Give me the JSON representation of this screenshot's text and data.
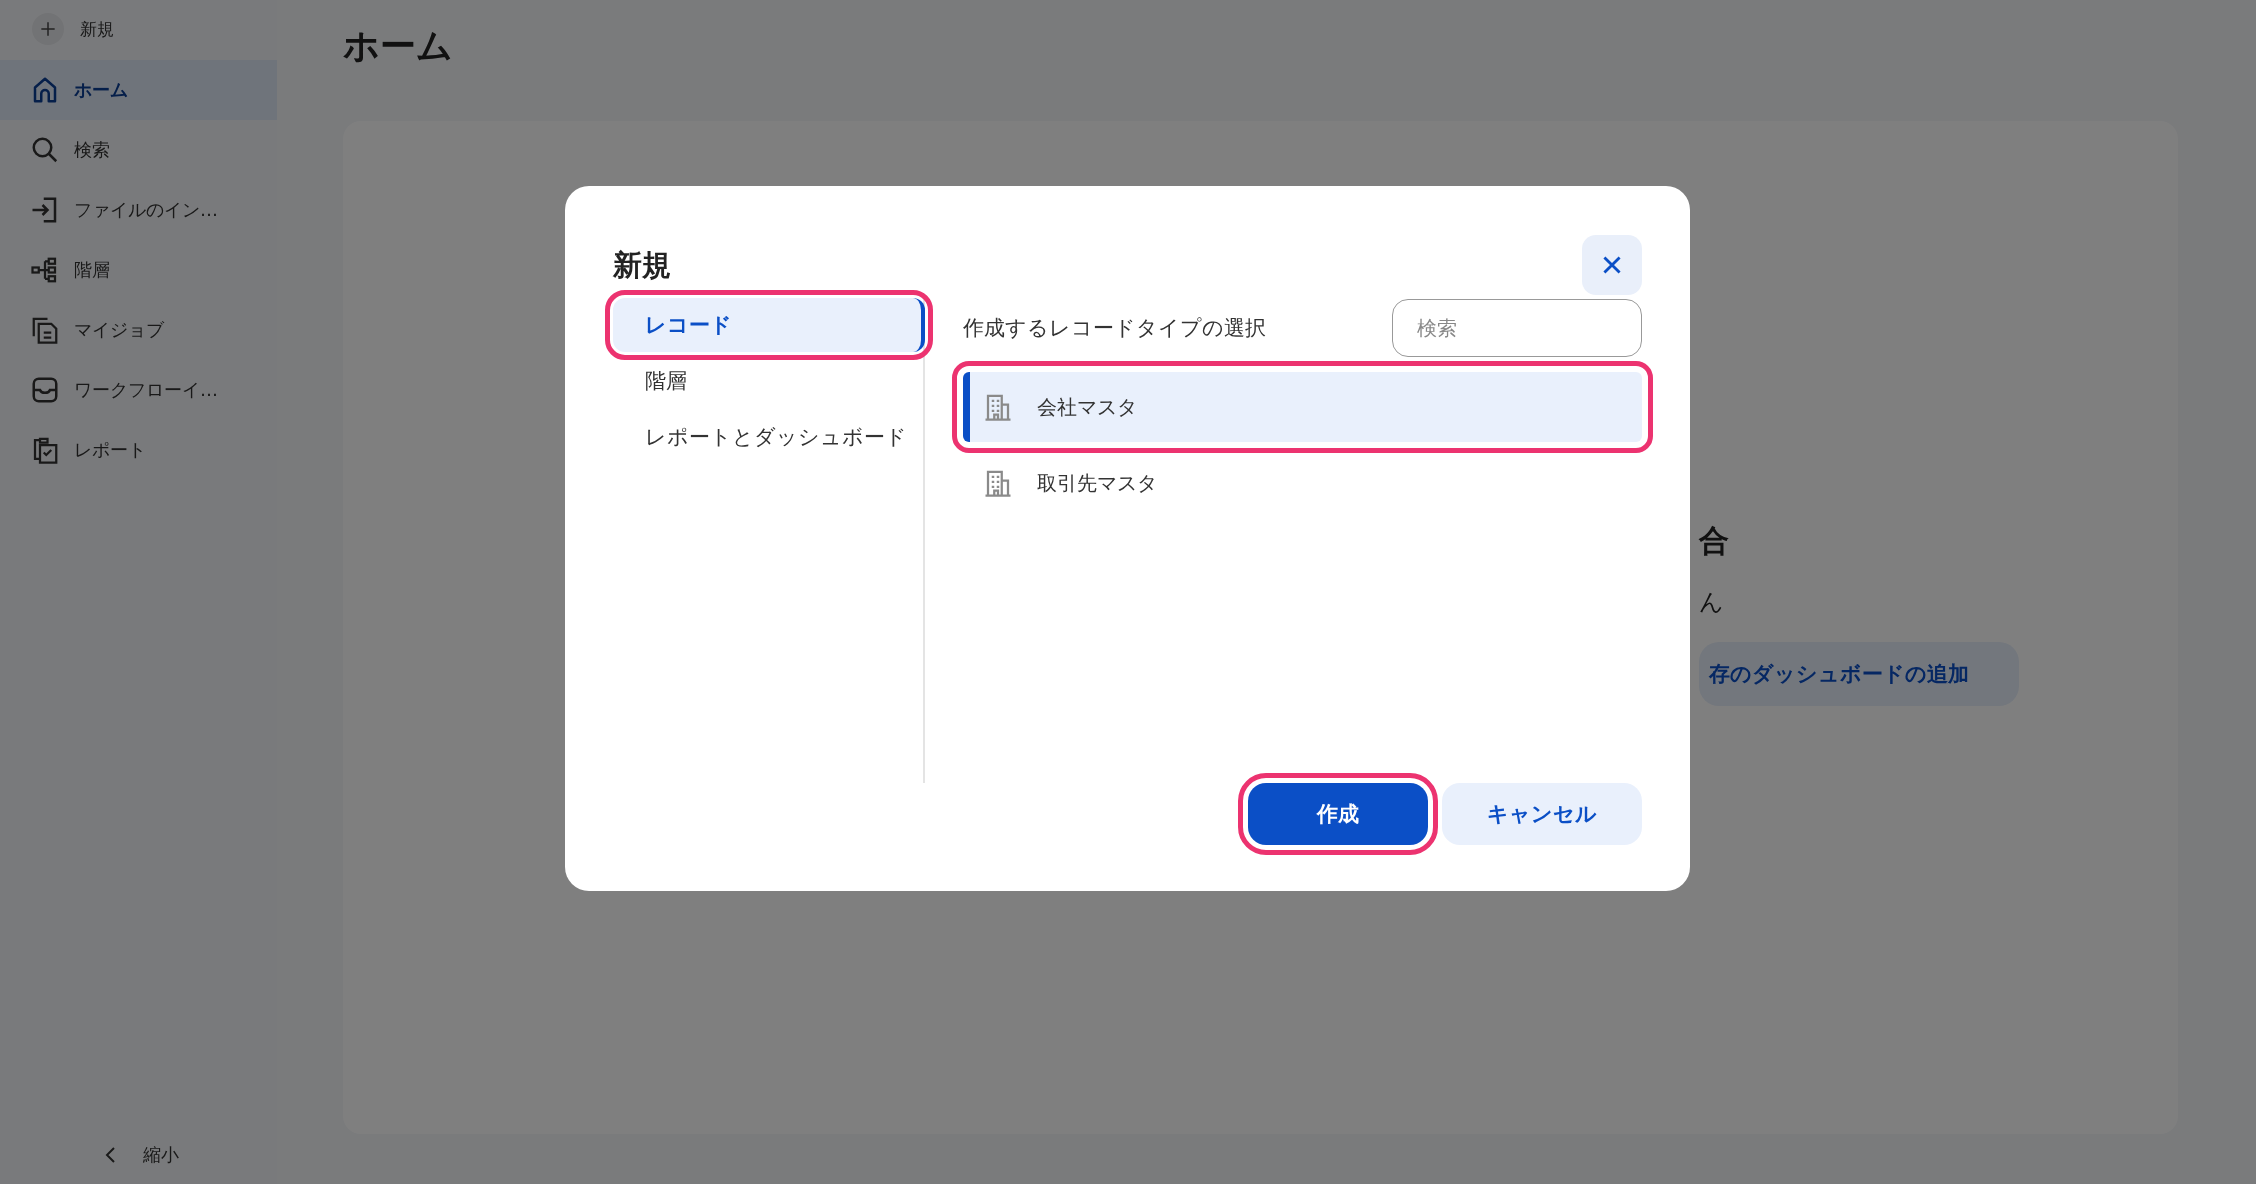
{
  "sidebar": {
    "new_button": {
      "label": "新規"
    },
    "items": [
      {
        "label": "ホーム",
        "selected": true
      },
      {
        "label": "検索",
        "selected": false
      },
      {
        "label": "ファイルのイン…",
        "selected": false
      },
      {
        "label": "階層",
        "selected": false
      },
      {
        "label": "マイジョブ",
        "selected": false
      },
      {
        "label": "ワークフローイ…",
        "selected": false
      },
      {
        "label": "レポート",
        "selected": false
      }
    ],
    "collapse_button": {
      "label": "縮小"
    }
  },
  "page": {
    "title": "ホーム",
    "card_texts": [
      "合",
      "ん"
    ],
    "card_button": "存のダッシュボードの追加"
  },
  "dialog": {
    "title": "新規",
    "nav": [
      {
        "label": "レコード",
        "selected": true,
        "highlighted": true
      },
      {
        "label": "階層",
        "selected": false,
        "highlighted": false
      },
      {
        "label": "レポートとダッシュボード",
        "selected": false,
        "highlighted": false
      }
    ],
    "prompt": "作成するレコードタイプの選択",
    "search": {
      "placeholder": "検索"
    },
    "record_types": [
      {
        "label": "会社マスタ",
        "selected": true,
        "highlighted": true
      },
      {
        "label": "取引先マスタ",
        "selected": false,
        "highlighted": false
      }
    ],
    "buttons": [
      {
        "kind": "primary",
        "label": "作成",
        "highlighted": true
      },
      {
        "kind": "secondary",
        "label": "キャンセル",
        "highlighted": false
      }
    ]
  }
}
